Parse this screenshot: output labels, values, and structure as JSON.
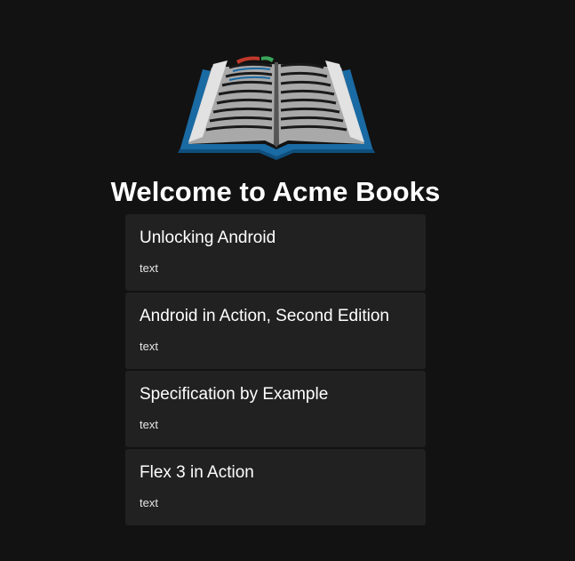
{
  "header": {
    "logo_icon": "open-book-icon",
    "title": "Welcome to Acme Books"
  },
  "books": [
    {
      "title": "Unlocking Android",
      "subtitle": "text"
    },
    {
      "title": "Android in Action, Second Edition",
      "subtitle": "text"
    },
    {
      "title": "Specification by Example",
      "subtitle": "text"
    },
    {
      "title": "Flex 3 in Action",
      "subtitle": "text"
    }
  ],
  "colors": {
    "background": "#121212",
    "card": "#212121",
    "book_cover": "#1a6aa3",
    "bookmark_red": "#c0392b",
    "bookmark_green": "#3aa55a"
  }
}
